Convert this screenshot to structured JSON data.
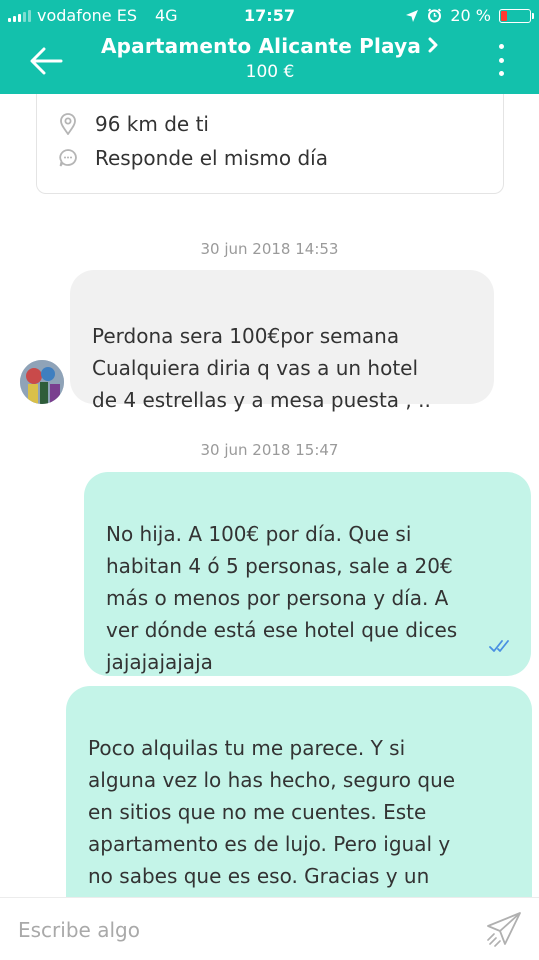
{
  "status_bar": {
    "carrier": "vodafone ES",
    "network": "4G",
    "time": "17:57",
    "battery_percent": "20 %",
    "battery_level": 0.2,
    "battery_color": "#ff3b30"
  },
  "header": {
    "title": "Apartamento Alicante Playa",
    "price": "100 €",
    "bg_color": "#13c1ac"
  },
  "info_card": {
    "distance": "96 km de ti",
    "response": "Responde el mismo día"
  },
  "messages": [
    {
      "timestamp": "30 jun 2018 14:53",
      "direction": "in",
      "text": "Perdona sera 100€por semana\nCualquiera diria q vas a un hotel\nde 4 estrellas y a mesa puesta , .."
    },
    {
      "timestamp": "30 jun 2018 15:47",
      "direction": "out",
      "text": "No hija. A 100€ por día. Que si\nhabitan 4 ó 5 personas, sale a 20€\nmás o menos por persona y día. A\nver dónde está ese hotel que dices\njajajajajaja",
      "read": true
    },
    {
      "direction": "out",
      "text": "Poco alquilas tu me parece. Y si\nalguna vez lo has hecho, seguro que\nen sitios que no me cuentes. Este\napartamento es de lujo. Pero igual y\nno sabes que es eso. Gracias y un\nsaludo"
    }
  ],
  "composer": {
    "placeholder": "Escribe algo"
  },
  "icons": {
    "back": "arrow-left-icon",
    "menu": "more-vertical-icon",
    "location": "location-pin-icon",
    "response": "chat-bubble-icon",
    "read": "double-check-icon",
    "send": "paper-plane-icon"
  },
  "colors": {
    "incoming_bubble": "#f1f1f1",
    "outgoing_bubble": "#c4f4e8",
    "read_check": "#4a90e2"
  }
}
